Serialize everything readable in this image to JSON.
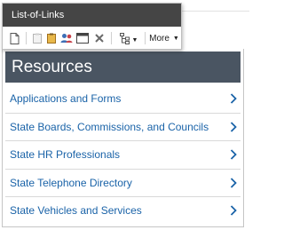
{
  "editor": {
    "title": "List-of-Links",
    "toolbar": {
      "more_label": "More",
      "icons": [
        "page-icon",
        "paste-icon",
        "paste-word-icon",
        "users-icon",
        "window-icon",
        "remove-icon",
        "tree-icon"
      ]
    }
  },
  "resources": {
    "title": "Resources",
    "items": [
      {
        "label": "Applications and Forms"
      },
      {
        "label": "State Boards, Commissions, and Councils"
      },
      {
        "label": "State HR Professionals"
      },
      {
        "label": "State Telephone Directory"
      },
      {
        "label": "State Vehicles and Services"
      }
    ]
  },
  "colors": {
    "header_bg": "#4a5562",
    "link_color": "#1a63a8",
    "editor_title_bg": "#454545"
  }
}
